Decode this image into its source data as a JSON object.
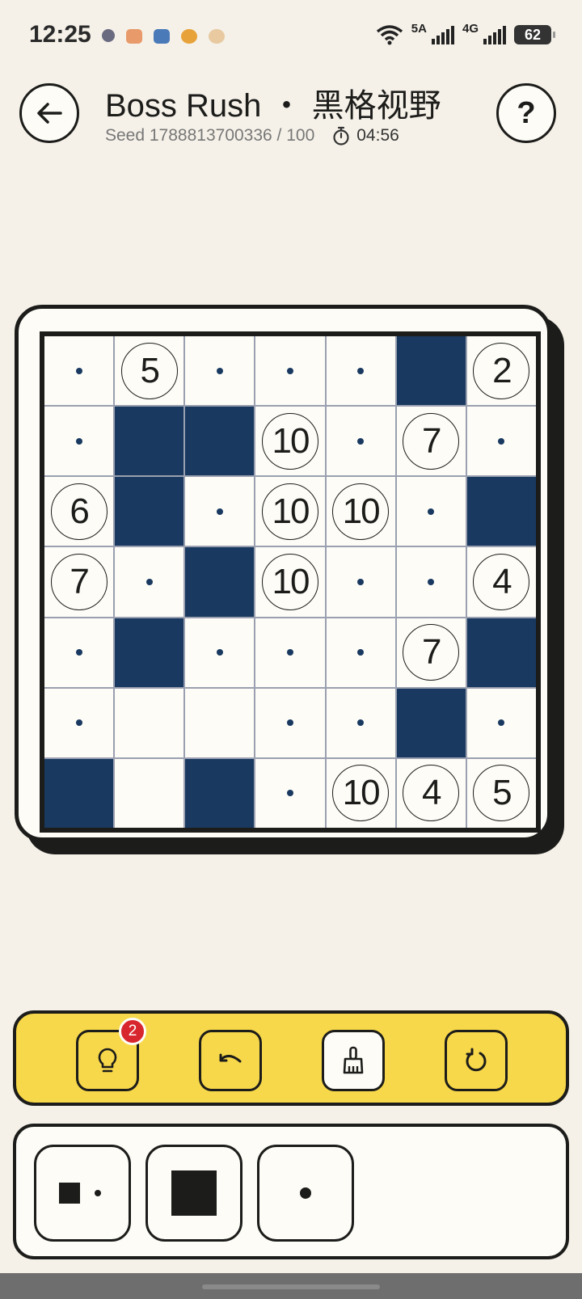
{
  "status_bar": {
    "time": "12:25",
    "network_a": "5A",
    "network_b": "4G",
    "battery": "62",
    "notification_colors": [
      "#6a6a80",
      "#e89a6a",
      "#4a7ab8",
      "#e8a23a",
      "#e8c9a0"
    ]
  },
  "header": {
    "title": "Boss Rush ・ 黑格视野",
    "seed": "Seed 1788813700336 / 100",
    "timer": "04:56",
    "back_icon": "arrow-left-icon",
    "help_label": "?"
  },
  "board": {
    "size": 7,
    "cells": [
      [
        "dot",
        "5",
        "dot",
        "dot",
        "dot",
        "fill",
        "2"
      ],
      [
        "dot",
        "fill",
        "fill",
        "10",
        "dot",
        "7",
        "dot"
      ],
      [
        "6",
        "fill",
        "dot",
        "10",
        "10",
        "dot",
        "fill"
      ],
      [
        "7",
        "dot",
        "fill",
        "10",
        "dot",
        "dot",
        "4"
      ],
      [
        "dot",
        "fill",
        "dot",
        "dot",
        "dot",
        "7",
        "fill"
      ],
      [
        "dot",
        "empty",
        "empty",
        "dot",
        "dot",
        "fill",
        "dot"
      ],
      [
        "fill",
        "empty",
        "fill",
        "dot",
        "10",
        "4",
        "5"
      ]
    ],
    "fill_color": "#193960"
  },
  "toolbar": {
    "hint_badge": "2",
    "tools": [
      "lightbulb-icon",
      "undo-icon",
      "broom-icon",
      "restart-icon"
    ],
    "active_tool": "broom-icon",
    "accent": "#f7d84a"
  },
  "modes": [
    "square-dot-mode-icon",
    "fill-square-mode-icon",
    "dot-mode-icon"
  ]
}
